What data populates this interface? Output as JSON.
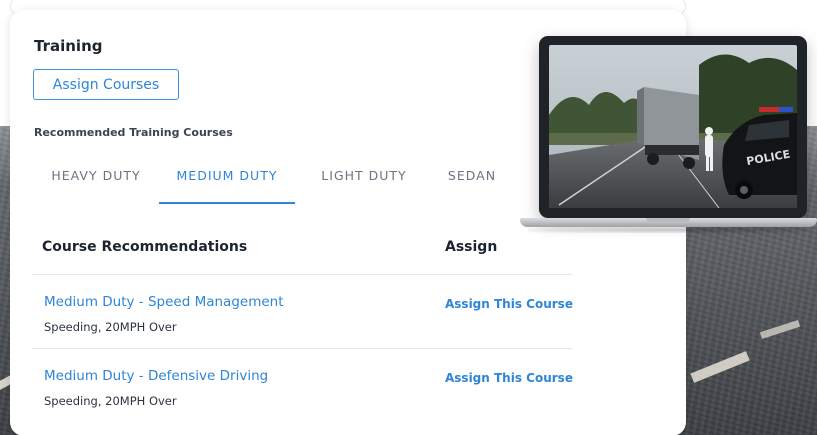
{
  "training": {
    "title": "Training",
    "assign_button": "Assign Courses",
    "subtitle": "Recommended Training Courses"
  },
  "tabs": [
    {
      "label": "HEAVY DUTY",
      "active": false
    },
    {
      "label": "MEDIUM DUTY",
      "active": true
    },
    {
      "label": "LIGHT DUTY",
      "active": false
    },
    {
      "label": "SEDAN",
      "active": false
    }
  ],
  "table": {
    "headers": {
      "course": "Course Recommendations",
      "assign": "Assign"
    },
    "rows": [
      {
        "title": "Medium Duty - Speed Management",
        "subtitle": "Speeding, 20MPH Over",
        "action": "Assign This Course"
      },
      {
        "title": "Medium Duty - Defensive Driving",
        "subtitle": "Speeding, 20MPH Over",
        "action": "Assign This Course"
      }
    ]
  },
  "laptop_screen": {
    "description_icon": "driving-simulation-image",
    "police_text": "POLICE"
  },
  "colors": {
    "accent": "#2f86d6",
    "text_dark": "#1c2430",
    "text_muted": "#6b7480"
  }
}
